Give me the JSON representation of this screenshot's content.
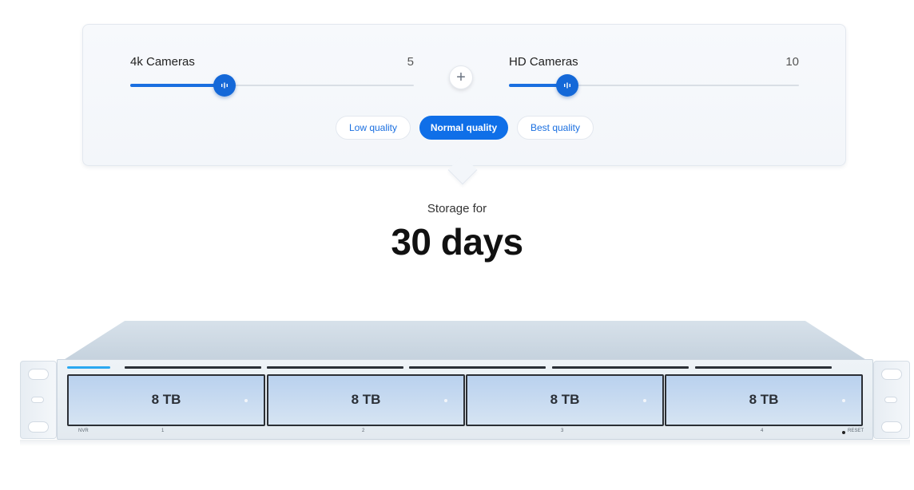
{
  "sliders": {
    "cameras_4k": {
      "label": "4k Cameras",
      "value": "5",
      "level": 0.333
    },
    "cameras_hd": {
      "label": "HD Cameras",
      "value": "10",
      "level": 0.2
    }
  },
  "plus_symbol": "+",
  "quality_options": [
    {
      "label": "Low quality",
      "selected": false
    },
    {
      "label": "Normal quality",
      "selected": true
    },
    {
      "label": "Best quality",
      "selected": false
    }
  ],
  "result": {
    "label": "Storage for",
    "value": "30 days"
  },
  "device": {
    "model_label": "NVR",
    "bays": [
      {
        "number": "1",
        "capacity": "8 TB"
      },
      {
        "number": "2",
        "capacity": "8 TB"
      },
      {
        "number": "3",
        "capacity": "8 TB"
      },
      {
        "number": "4",
        "capacity": "8 TB"
      }
    ],
    "reset_label": "RESET"
  },
  "colors": {
    "accent": "#0f6fe8",
    "status_led": "#2aa8f0",
    "bay_fill": "#c3d8f0"
  },
  "icons": {
    "slider_thumb": "grip-lines-icon",
    "add": "plus-icon"
  }
}
